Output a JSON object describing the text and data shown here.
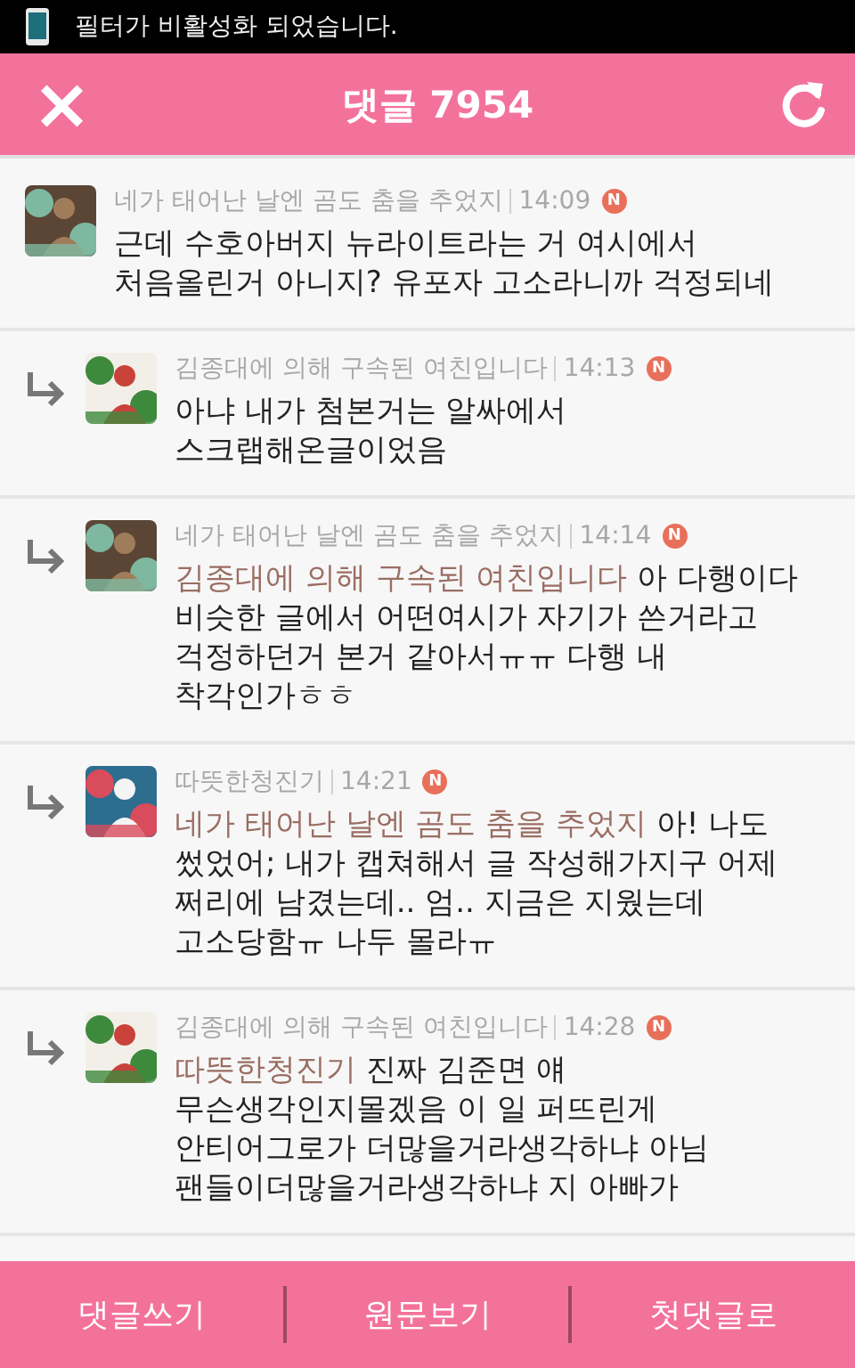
{
  "status_bar": {
    "notification": "필터가 비활성화 되었습니다."
  },
  "header": {
    "close": "×",
    "title": "댓글 7954"
  },
  "comments": [
    {
      "kind": "comment",
      "author": "네가 태어난 날엔 곰도 춤을 추었지",
      "time": "14:09",
      "badge": "N",
      "text": "근데 수호아버지 뉴라이트라는 거 여시에서\n처음올린거 아니지? 유포자 고소라니까 걱정되네"
    },
    {
      "kind": "reply",
      "author": "김종대에 의해 구속된 여친입니다",
      "time": "14:13",
      "badge": "N",
      "text": "아냐 내가 첨본거는 알싸에서\n스크랩해온글이었음"
    },
    {
      "kind": "reply",
      "author": "네가 태어난 날엔 곰도 춤을 추었지",
      "time": "14:14",
      "badge": "N",
      "mention": "김종대에 의해 구속된 여친입니다",
      "text": " 아 다행이다\n비슷한 글에서 어떤여시가 자기가 쓴거라고\n걱정하던거 본거 같아서ㅠㅠ 다행 내\n착각인가ㅎㅎ"
    },
    {
      "kind": "reply",
      "author": "따뜻한청진기",
      "time": "14:21",
      "badge": "N",
      "mention": "네가 태어난 날엔 곰도 춤을 추었지",
      "text": " 아! 나도\n썼었어; 내가 캡쳐해서 글 작성해가지구 어제\n쩌리에 남겼는데.. 엄.. 지금은 지웠는데\n고소당함ㅠ 나두 몰라ㅠ"
    },
    {
      "kind": "reply",
      "author": "김종대에 의해 구속된 여친입니다",
      "time": "14:28",
      "badge": "N",
      "mention": "따뜻한청진기",
      "text": " 진짜 김준면 얘\n무슨생각인지몰겠음 이 일 퍼뜨린게\n안티어그로가 더많을거라생각하냐 아님\n팬들이더많을거라생각하냐 지 아빠가"
    }
  ],
  "bottom_bar": [
    "댓글쓰기",
    "원문보기",
    "첫댓글로"
  ]
}
